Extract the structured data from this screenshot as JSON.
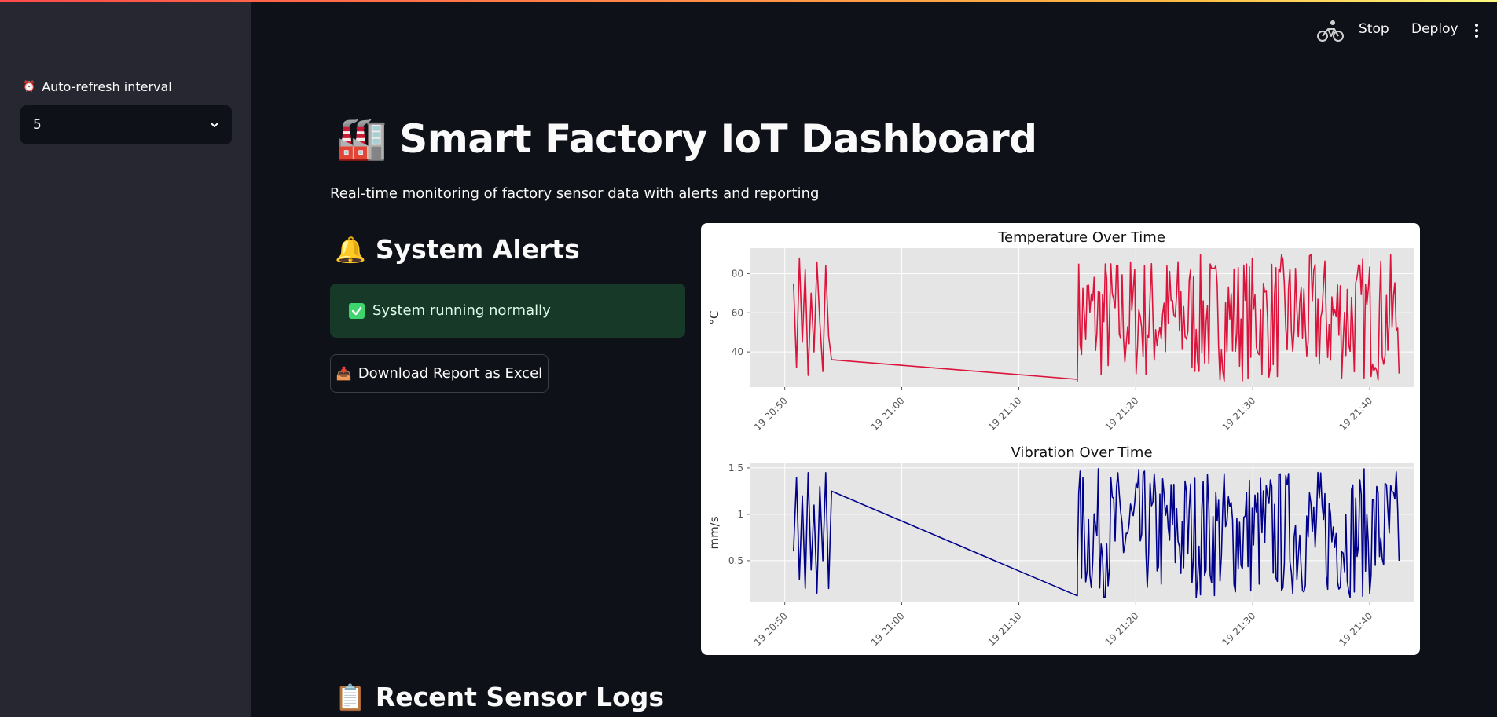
{
  "sidebar": {
    "label": "Auto-refresh interval",
    "select_value": "5"
  },
  "header": {
    "stop_label": "Stop",
    "deploy_label": "Deploy"
  },
  "main": {
    "title": "Smart Factory IoT Dashboard",
    "subtitle": "Real-time monitoring of factory sensor data with alerts and reporting",
    "alerts_heading": "System Alerts",
    "alert_message": "System running normally",
    "download_label": "Download Report as Excel",
    "logs_heading": "Recent Sensor Logs"
  },
  "colors": {
    "temperature": "#dc143c",
    "vibration": "#00008b",
    "success_bg": "#173928",
    "accent": "#ff4b4b"
  },
  "chart_data": [
    {
      "type": "line",
      "title": "Temperature Over Time",
      "xlabel": "",
      "ylabel": "°C",
      "x_ticks": [
        "19 20:50",
        "19 21:00",
        "19 21:10",
        "19 21:20",
        "19 21:30",
        "19 21:40"
      ],
      "y_ticks": [
        40,
        60,
        80
      ],
      "ylim": [
        22,
        93
      ],
      "grid": true,
      "series": [
        {
          "segments": [
            {
              "x": [
                "20:50:45",
                "20:51:00",
                "20:51:15",
                "20:51:30",
                "20:51:45",
                "20:52:00",
                "20:52:15",
                "20:52:30",
                "20:52:45",
                "20:53:00",
                "20:53:15",
                "20:53:30",
                "20:53:45",
                "20:54:00"
              ],
              "y": [
                75,
                32,
                88,
                45,
                82,
                28,
                70,
                40,
                86,
                55,
                30,
                84,
                48,
                36
              ]
            },
            {
              "x": [
                "20:54:00",
                "21:15:00"
              ],
              "y": [
                36,
                26
              ]
            },
            {
              "x_range": [
                "21:15:00",
                "21:42:30"
              ],
              "y_min": 25,
              "y_max": 90,
              "pattern": "noisy"
            }
          ]
        }
      ]
    },
    {
      "type": "line",
      "title": "Vibration Over Time",
      "xlabel": "",
      "ylabel": "mm/s",
      "x_ticks": [
        "19 20:50",
        "19 21:00",
        "19 21:10",
        "19 21:20",
        "19 21:30",
        "19 21:40"
      ],
      "y_ticks": [
        0.5,
        1.0,
        1.5
      ],
      "ylim": [
        0.05,
        1.55
      ],
      "grid": true,
      "series": [
        {
          "segments": [
            {
              "x": [
                "20:50:45",
                "20:51:00",
                "20:51:15",
                "20:51:30",
                "20:51:45",
                "20:52:00",
                "20:52:15",
                "20:52:30",
                "20:52:45",
                "20:53:00",
                "20:53:15",
                "20:53:30",
                "20:53:45",
                "20:54:00"
              ],
              "y": [
                0.6,
                1.4,
                0.3,
                1.2,
                0.2,
                1.45,
                0.4,
                1.1,
                0.15,
                1.3,
                0.5,
                1.45,
                0.2,
                1.25
              ]
            },
            {
              "x": [
                "20:54:00",
                "21:15:00"
              ],
              "y": [
                1.25,
                0.12
              ]
            },
            {
              "x_range": [
                "21:15:00",
                "21:42:30"
              ],
              "y_min": 0.1,
              "y_max": 1.5,
              "pattern": "noisy"
            }
          ]
        }
      ]
    }
  ]
}
